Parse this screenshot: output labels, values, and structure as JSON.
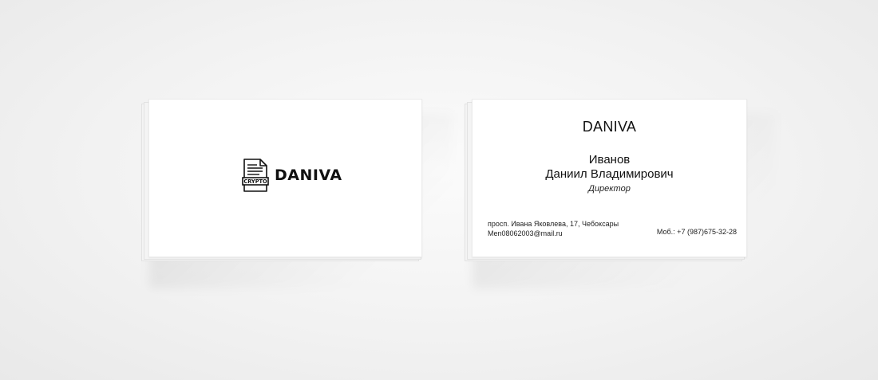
{
  "front_card": {
    "logo_badge_text": "CRYPTO",
    "logo_icon": "document-icon",
    "brand": "DANIVA"
  },
  "back_card": {
    "brand": "DANIVA",
    "surname": "Иванов",
    "given_names": "Даниил Владимирович",
    "position": "Директор",
    "address": "просп. Ивана Яковлева, 17, Чебоксары",
    "email": "Men08062003@mail.ru",
    "phone": "Моб.: +7 (987)675-32-28"
  }
}
